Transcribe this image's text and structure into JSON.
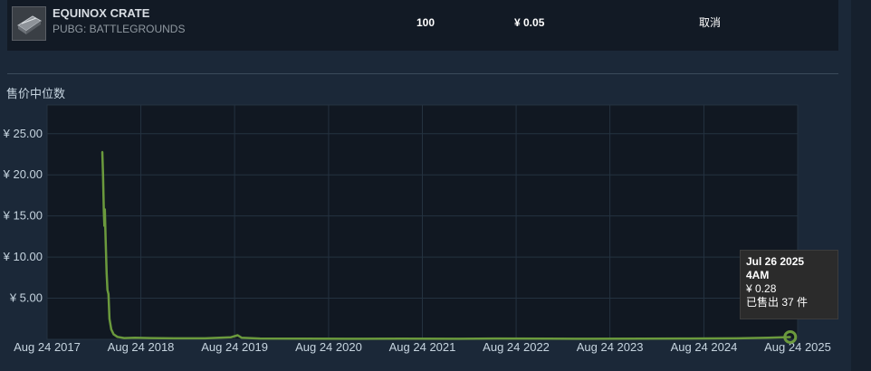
{
  "listing": {
    "item_name": "EQUINOX CRATE",
    "game": "PUBG: BATTLEGROUNDS",
    "quantity": "100",
    "price": "¥ 0.05",
    "cancel_label": "取消"
  },
  "chart_heading": "售价中位数",
  "tooltip": {
    "date": "Jul 26 2025",
    "time": "4AM",
    "price": "¥ 0.28",
    "sold": "已售出 37 件"
  },
  "colors": {
    "line": "#6b9a3d",
    "plot_bg": "#111822",
    "grid": "#243240",
    "page_bg": "#1b2838"
  },
  "chart_data": {
    "type": "line",
    "title": "售价中位数",
    "xlabel": "",
    "ylabel": "",
    "xlim": [
      "2017-08-24",
      "2025-08-24"
    ],
    "ylim": [
      0,
      28.5
    ],
    "grid": true,
    "y_ticks": [
      {
        "value": 5,
        "label": "¥ 5.00"
      },
      {
        "value": 10,
        "label": "¥ 10.00"
      },
      {
        "value": 15,
        "label": "¥ 15.00"
      },
      {
        "value": 20,
        "label": "¥ 20.00"
      },
      {
        "value": 25,
        "label": "¥ 25.00"
      }
    ],
    "x_ticks": [
      {
        "value": "2017-08-24",
        "label": "Aug 24 2017"
      },
      {
        "value": "2018-08-24",
        "label": "Aug 24 2018"
      },
      {
        "value": "2019-08-24",
        "label": "Aug 24 2019"
      },
      {
        "value": "2020-08-24",
        "label": "Aug 24 2020"
      },
      {
        "value": "2021-08-24",
        "label": "Aug 24 2021"
      },
      {
        "value": "2022-08-24",
        "label": "Aug 24 2022"
      },
      {
        "value": "2023-08-24",
        "label": "Aug 24 2023"
      },
      {
        "value": "2024-08-24",
        "label": "Aug 24 2024"
      },
      {
        "value": "2025-08-24",
        "label": "Aug 24 2025"
      }
    ],
    "series": [
      {
        "points": [
          [
            "2018-03-27",
            22.8
          ],
          [
            "2018-03-30",
            20.0
          ],
          [
            "2018-04-02",
            15.5
          ],
          [
            "2018-04-04",
            13.8
          ],
          [
            "2018-04-06",
            15.8
          ],
          [
            "2018-04-09",
            12.0
          ],
          [
            "2018-04-13",
            8.0
          ],
          [
            "2018-04-16",
            6.0
          ],
          [
            "2018-04-20",
            5.5
          ],
          [
            "2018-04-24",
            2.5
          ],
          [
            "2018-05-01",
            1.2
          ],
          [
            "2018-05-10",
            0.6
          ],
          [
            "2018-05-25",
            0.3
          ],
          [
            "2018-06-20",
            0.15
          ],
          [
            "2018-08-01",
            0.2
          ],
          [
            "2018-10-01",
            0.15
          ],
          [
            "2019-01-01",
            0.12
          ],
          [
            "2019-05-01",
            0.12
          ],
          [
            "2019-08-10",
            0.25
          ],
          [
            "2019-09-05",
            0.5
          ],
          [
            "2019-09-20",
            0.2
          ],
          [
            "2019-12-01",
            0.1
          ],
          [
            "2020-06-01",
            0.08
          ],
          [
            "2021-01-01",
            0.07
          ],
          [
            "2021-06-01",
            0.08
          ],
          [
            "2022-01-01",
            0.07
          ],
          [
            "2022-06-01",
            0.1
          ],
          [
            "2023-01-01",
            0.08
          ],
          [
            "2023-06-01",
            0.07
          ],
          [
            "2024-01-01",
            0.08
          ],
          [
            "2024-06-01",
            0.1
          ],
          [
            "2025-01-01",
            0.12
          ],
          [
            "2025-05-01",
            0.2
          ],
          [
            "2025-07-26",
            0.28
          ]
        ]
      }
    ],
    "highlight_point": [
      "2025-07-26",
      0.28
    ]
  }
}
